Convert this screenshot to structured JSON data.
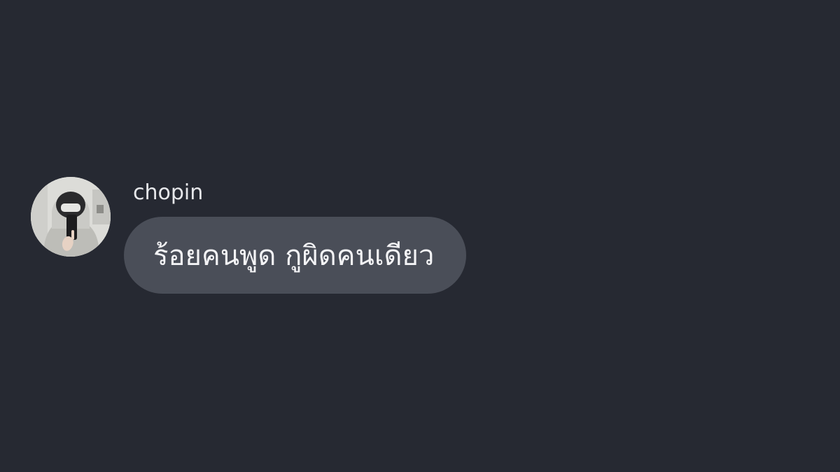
{
  "message": {
    "sender": "chopin",
    "text": "ร้อยคนพูด กูผิดคนเดียว"
  },
  "avatar": {
    "icon": "profile-photo-hooded-person-icon"
  },
  "colors": {
    "background": "#262932",
    "bubble": "#4a4e58",
    "username_text": "#e6e7ea",
    "message_text": "#f3f3f5"
  }
}
